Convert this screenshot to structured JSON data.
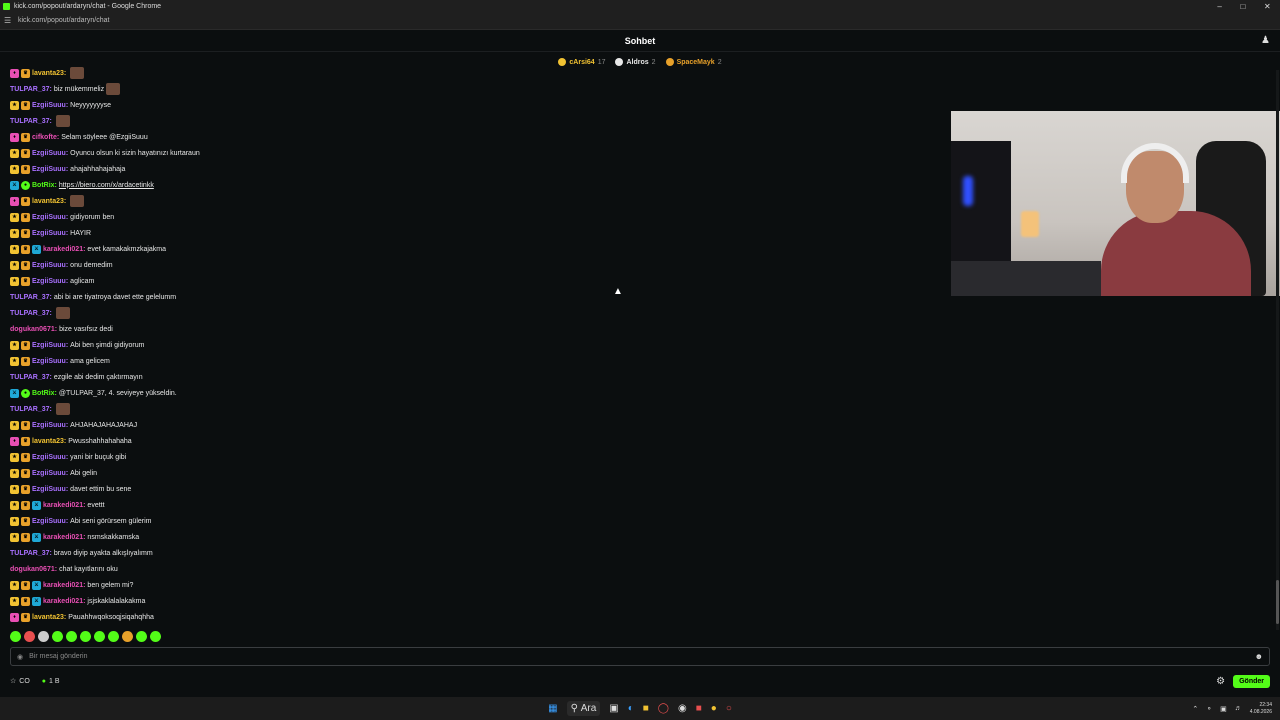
{
  "browser": {
    "window_title": "kick.com/popout/ardaryn/chat - Google Chrome",
    "url": "kick.com/popout/ardaryn/chat"
  },
  "chat": {
    "title": "Sohbet",
    "pinned": [
      {
        "name": "cArsi64",
        "count": "17",
        "color": "#f1c232"
      },
      {
        "name": "Aldros",
        "count": "2",
        "color": "#e8e8e8"
      },
      {
        "name": "SpaceMayk",
        "count": "2",
        "color": "#e8a12a"
      }
    ],
    "messages": [
      {
        "badges": [
          "vip",
          "crown"
        ],
        "user": "lavanta23:",
        "color": "#f1c232",
        "text": "",
        "emote": true
      },
      {
        "badges": [],
        "user": "TULPAR_37:",
        "color": "#a970ff",
        "text": "biz mükemmeliz",
        "emote": true
      },
      {
        "badges": [
          "sub",
          "crown"
        ],
        "user": "EzgiiSuuu:",
        "color": "#a970ff",
        "text": "Neyyyyyyyse",
        "emote": false
      },
      {
        "badges": [],
        "user": "TULPAR_37:",
        "color": "#a970ff",
        "text": "",
        "emote": true
      },
      {
        "badges": [
          "vip",
          "crown"
        ],
        "user": "cifkofte:",
        "color": "#e84fb4",
        "text": "Selam söyleee @EzgiiSuuu",
        "emote": false
      },
      {
        "badges": [
          "sub",
          "crown"
        ],
        "user": "EzgiiSuuu:",
        "color": "#a970ff",
        "text": "Oyuncu olsun ki sizin hayatınızı kurtaraun",
        "emote": false
      },
      {
        "badges": [
          "sub",
          "crown"
        ],
        "user": "EzgiiSuuu:",
        "color": "#a970ff",
        "text": "ahajahhahajahaja",
        "emote": false
      },
      {
        "badges": [
          "mod",
          "bot"
        ],
        "user": "BotRix:",
        "color": "#53fc18",
        "text": "https://biero.com/x/ardacetinkk",
        "emote": false,
        "link": true
      },
      {
        "badges": [
          "vip",
          "crown"
        ],
        "user": "lavanta23:",
        "color": "#f1c232",
        "text": "",
        "emote": true
      },
      {
        "badges": [
          "sub",
          "crown"
        ],
        "user": "EzgiiSuuu:",
        "color": "#a970ff",
        "text": "gidiyorum ben",
        "emote": false
      },
      {
        "badges": [
          "sub",
          "crown"
        ],
        "user": "EzgiiSuuu:",
        "color": "#a970ff",
        "text": "HAYIR",
        "emote": false
      },
      {
        "badges": [
          "sub",
          "crown",
          "mod"
        ],
        "user": "karakedi021:",
        "color": "#e84fb4",
        "text": "evet kamakakmzkajakma",
        "emote": false
      },
      {
        "badges": [
          "sub",
          "crown"
        ],
        "user": "EzgiiSuuu:",
        "color": "#a970ff",
        "text": "onu demedim",
        "emote": false
      },
      {
        "badges": [
          "sub",
          "crown"
        ],
        "user": "EzgiiSuuu:",
        "color": "#a970ff",
        "text": "aglicam",
        "emote": false
      },
      {
        "badges": [],
        "user": "TULPAR_37:",
        "color": "#a970ff",
        "text": "abi bi are tiyatroya davet ette gelelumm",
        "emote": false
      },
      {
        "badges": [],
        "user": "TULPAR_37:",
        "color": "#a970ff",
        "text": "",
        "emote": true
      },
      {
        "badges": [],
        "user": "dogukan0671:",
        "color": "#e84fb4",
        "text": "bize vasıfsız dedi",
        "emote": false
      },
      {
        "badges": [
          "sub",
          "crown"
        ],
        "user": "EzgiiSuuu:",
        "color": "#a970ff",
        "text": "Abi ben şimdi gidiyorum",
        "emote": false
      },
      {
        "badges": [
          "sub",
          "crown"
        ],
        "user": "EzgiiSuuu:",
        "color": "#a970ff",
        "text": "ama gelicem",
        "emote": false
      },
      {
        "badges": [],
        "user": "TULPAR_37:",
        "color": "#a970ff",
        "text": "ezgile abi dedim çaktırmayın",
        "emote": false
      },
      {
        "badges": [
          "mod",
          "bot"
        ],
        "user": "BotRix:",
        "color": "#53fc18",
        "text": "@TULPAR_37, 4. seviyeye yükseldin.",
        "emote": false
      },
      {
        "badges": [],
        "user": "TULPAR_37:",
        "color": "#a970ff",
        "text": "",
        "emote": true
      },
      {
        "badges": [
          "sub",
          "crown"
        ],
        "user": "EzgiiSuuu:",
        "color": "#a970ff",
        "text": "AHJAHAJAHAJAHAJ",
        "emote": false
      },
      {
        "badges": [
          "vip",
          "crown"
        ],
        "user": "lavanta23:",
        "color": "#f1c232",
        "text": "Pwusshahhahahaha",
        "emote": false
      },
      {
        "badges": [
          "sub",
          "crown"
        ],
        "user": "EzgiiSuuu:",
        "color": "#a970ff",
        "text": "yani bir buçuk gibi",
        "emote": false
      },
      {
        "badges": [
          "sub",
          "crown"
        ],
        "user": "EzgiiSuuu:",
        "color": "#a970ff",
        "text": "Abi gelin",
        "emote": false
      },
      {
        "badges": [
          "sub",
          "crown"
        ],
        "user": "EzgiiSuuu:",
        "color": "#a970ff",
        "text": "davet ettim bu sene",
        "emote": false
      },
      {
        "badges": [
          "sub",
          "crown",
          "mod"
        ],
        "user": "karakedi021:",
        "color": "#e84fb4",
        "text": "evettt",
        "emote": false
      },
      {
        "badges": [
          "sub",
          "crown"
        ],
        "user": "EzgiiSuuu:",
        "color": "#a970ff",
        "text": "Abi seni görürsem gülerim",
        "emote": false
      },
      {
        "badges": [
          "sub",
          "crown",
          "mod"
        ],
        "user": "karakedi021:",
        "color": "#e84fb4",
        "text": "nsmskakkamska",
        "emote": false
      },
      {
        "badges": [],
        "user": "TULPAR_37:",
        "color": "#a970ff",
        "text": "bravo diyip ayakta alkışlıyalımm",
        "emote": false
      },
      {
        "badges": [],
        "user": "dogukan0671:",
        "color": "#e84fb4",
        "text": "chat kayıtlarını oku",
        "emote": false
      },
      {
        "badges": [
          "sub",
          "crown",
          "mod"
        ],
        "user": "karakedi021:",
        "color": "#e84fb4",
        "text": "ben gelem mi?",
        "emote": false
      },
      {
        "badges": [
          "sub",
          "crown",
          "mod"
        ],
        "user": "karakedi021:",
        "color": "#e84fb4",
        "text": "jsjskaklalalakakma",
        "emote": false
      },
      {
        "badges": [
          "vip",
          "crown"
        ],
        "user": "lavanta23:",
        "color": "#f1c232",
        "text": "Pauahhwqoksoqjsiqahqhha",
        "emote": false
      }
    ],
    "input_placeholder": "Bir mesaj gönderin",
    "bottom_left_1": "CO",
    "bottom_left_2": "1 B",
    "send_label": "Gönder"
  },
  "taskbar": {
    "search_label": "Ara",
    "time": "22:34",
    "date": "4.08.2026"
  }
}
